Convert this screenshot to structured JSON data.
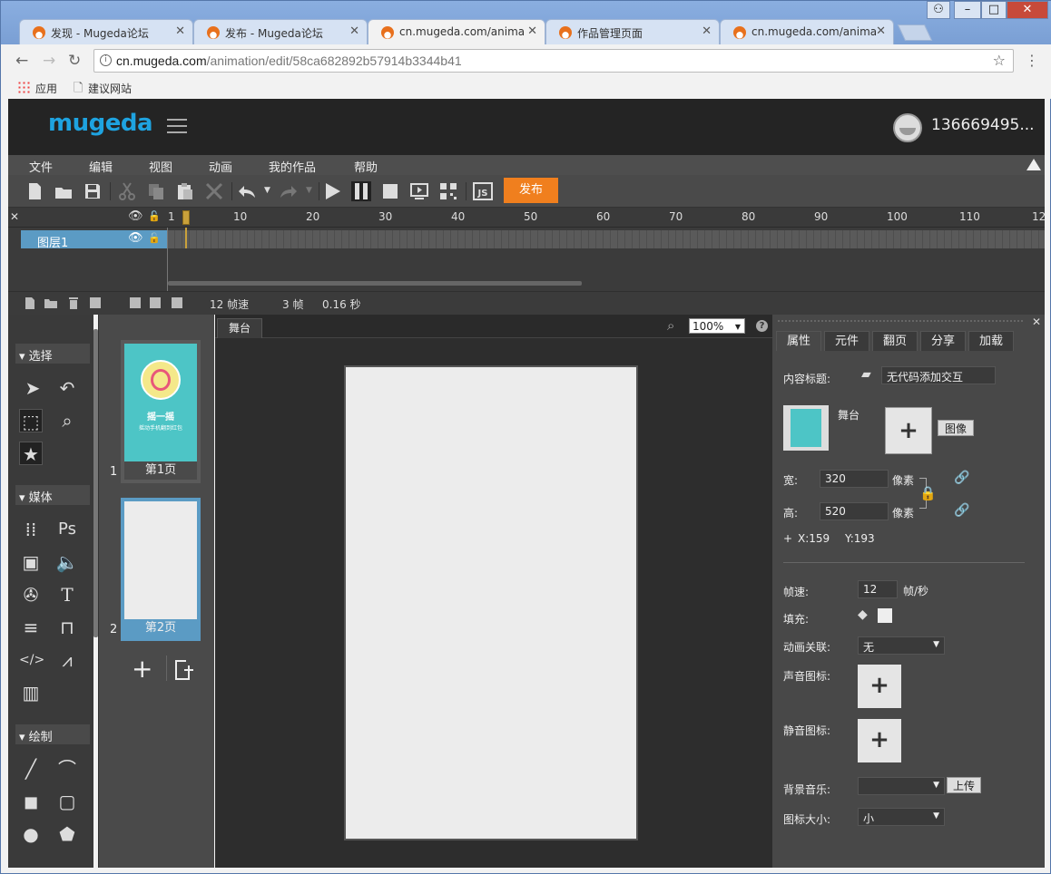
{
  "browser": {
    "tabs": [
      {
        "title": "发现 - Mugeda论坛"
      },
      {
        "title": "发布 - Mugeda论坛"
      },
      {
        "title": "cn.mugeda.com/anima"
      },
      {
        "title": "作品管理页面"
      },
      {
        "title": "cn.mugeda.com/anima"
      }
    ],
    "url_host": "cn.mugeda.com",
    "url_path": "/animation/edit/58ca682892b57914b3344b41",
    "bookmarks": [
      "应用",
      "建议网站"
    ]
  },
  "app": {
    "logo": "mugeda",
    "username": "136669495...",
    "menu": [
      "文件",
      "编辑",
      "视图",
      "动画",
      "我的作品",
      "帮助"
    ],
    "publish_label": "发布"
  },
  "timeline": {
    "ticks": [
      "1",
      "10",
      "20",
      "30",
      "40",
      "50",
      "60",
      "70",
      "80",
      "90",
      "100",
      "110",
      "12"
    ],
    "layer_name": "图层1",
    "fps_label": "12 帧速",
    "frames_label": "3 帧",
    "time_label": "0.16 秒"
  },
  "tools": {
    "section_select": "选择",
    "section_media": "媒体",
    "section_draw": "绘制"
  },
  "pages": {
    "items": [
      {
        "num": "1",
        "label": "第1页",
        "thumb_title": "摇一摇",
        "thumb_sub": "摇动手机翻到红包"
      },
      {
        "num": "2",
        "label": "第2页"
      }
    ]
  },
  "stage": {
    "tab": "舞台",
    "zoom": "100%"
  },
  "props": {
    "tabs": [
      "属性",
      "元件",
      "翻页",
      "分享",
      "加载"
    ],
    "content_title_label": "内容标题:",
    "content_title_value": "无代码添加交互",
    "stage_label": "舞台",
    "image_button": "图像",
    "width_label": "宽:",
    "width_value": "320",
    "height_label": "高:",
    "height_value": "520",
    "px_unit": "像素",
    "x_label": "X:159",
    "y_label": "Y:193",
    "fps_label": "帧速:",
    "fps_value": "12",
    "fps_unit": "帧/秒",
    "fill_label": "填充:",
    "anim_link_label": "动画关联:",
    "anim_link_value": "无",
    "sound_icon_label": "声音图标:",
    "mute_icon_label": "静音图标:",
    "bg_music_label": "背景音乐:",
    "upload_button": "上传",
    "icon_size_label": "图标大小:",
    "icon_size_value": "小"
  }
}
